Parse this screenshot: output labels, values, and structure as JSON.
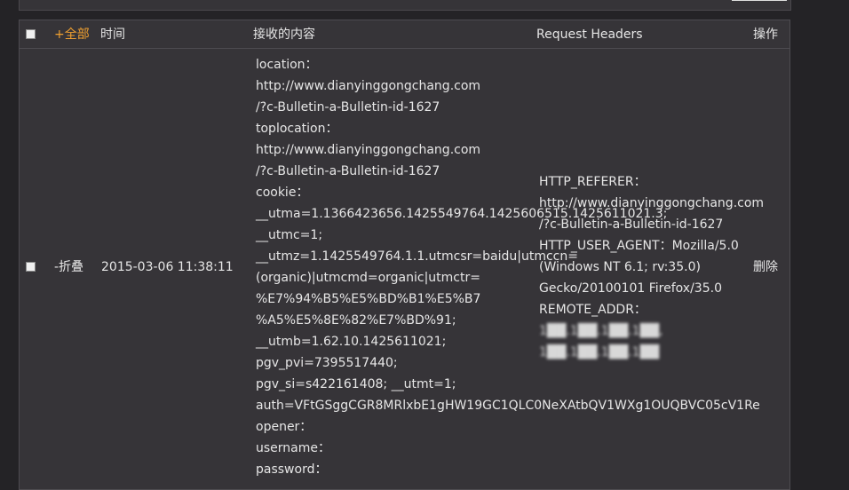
{
  "header": {
    "all_label": "+全部",
    "time_label": "时间",
    "content_label": "接收的内容",
    "headers_label": "Request Headers",
    "action_label": "操作"
  },
  "row": {
    "toggle_label": "-折叠",
    "time": "2015-03-06 11:38:11",
    "content_lines": [
      "location：",
      "http://www.dianyinggongchang.com",
      "/?c-Bulletin-a-Bulletin-id-1627",
      "toplocation：",
      "http://www.dianyinggongchang.com",
      "/?c-Bulletin-a-Bulletin-id-1627",
      "cookie：",
      "__utma=1.1366423656.1425549764.1425606515.1425611021.3;",
      "__utmc=1;",
      "__utmz=1.1425549764.1.1.utmcsr=baidu|utmccn=",
      "(organic)|utmcmd=organic|utmctr=",
      "%E7%94%B5%E5%BD%B1%E5%B7",
      "%A5%E5%8E%82%E7%BD%91;",
      "__utmb=1.62.10.1425611021;",
      "pgv_pvi=7395517440;",
      "pgv_si=s422161408; __utmt=1;",
      "auth=VFtGSggCGR8MRlxbE1gHW19GC1QLC0NeXAtbQV1WXg1OUQBVC05cV1Re",
      "opener：",
      "username：",
      "password："
    ],
    "header_lines": [
      "HTTP_REFERER：",
      "http://www.dianyinggongchang.com",
      "/?c-Bulletin-a-Bulletin-id-1627",
      "HTTP_USER_AGENT：Mozilla/5.0",
      "(Windows NT 6.1; rv:35.0)",
      "Gecko/20100101 Firefox/35.0",
      "REMOTE_ADDR："
    ],
    "blurred_lines": [
      "1██.1██.1██.1██,",
      "1██.1██.1██.1██"
    ],
    "delete_label": "删除"
  }
}
